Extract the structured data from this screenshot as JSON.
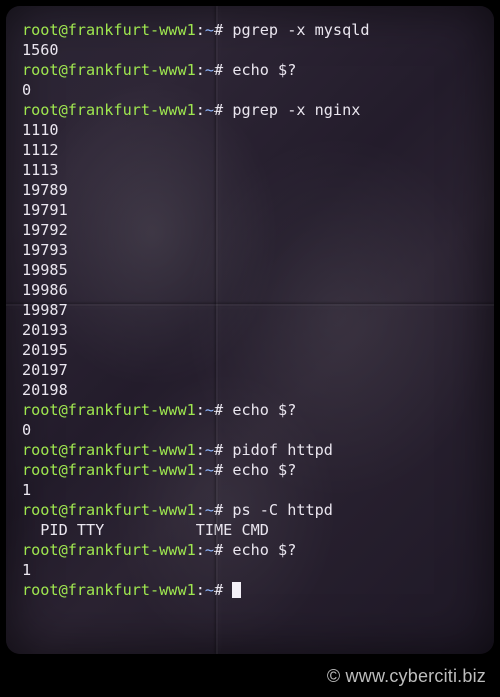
{
  "prompt": {
    "user": "root",
    "host": "frankfurt-www1",
    "path": "~",
    "sigil": "#"
  },
  "lines": [
    {
      "type": "cmd",
      "text": "pgrep -x mysqld"
    },
    {
      "type": "out",
      "text": "1560"
    },
    {
      "type": "cmd",
      "text": "echo $?"
    },
    {
      "type": "out",
      "text": "0"
    },
    {
      "type": "cmd",
      "text": "pgrep -x nginx"
    },
    {
      "type": "out",
      "text": "1110"
    },
    {
      "type": "out",
      "text": "1112"
    },
    {
      "type": "out",
      "text": "1113"
    },
    {
      "type": "out",
      "text": "19789"
    },
    {
      "type": "out",
      "text": "19791"
    },
    {
      "type": "out",
      "text": "19792"
    },
    {
      "type": "out",
      "text": "19793"
    },
    {
      "type": "out",
      "text": "19985"
    },
    {
      "type": "out",
      "text": "19986"
    },
    {
      "type": "out",
      "text": "19987"
    },
    {
      "type": "out",
      "text": "20193"
    },
    {
      "type": "out",
      "text": "20195"
    },
    {
      "type": "out",
      "text": "20197"
    },
    {
      "type": "out",
      "text": "20198"
    },
    {
      "type": "cmd",
      "text": "echo $?"
    },
    {
      "type": "out",
      "text": "0"
    },
    {
      "type": "cmd",
      "text": "pidof httpd"
    },
    {
      "type": "cmd",
      "text": "echo $?"
    },
    {
      "type": "out",
      "text": "1"
    },
    {
      "type": "cmd",
      "text": "ps -C httpd"
    },
    {
      "type": "out",
      "text": "  PID TTY          TIME CMD"
    },
    {
      "type": "cmd",
      "text": "echo $?"
    },
    {
      "type": "out",
      "text": "1"
    },
    {
      "type": "cmd",
      "text": "",
      "cursor": true
    }
  ],
  "watermark": "© www.cyberciti.biz"
}
